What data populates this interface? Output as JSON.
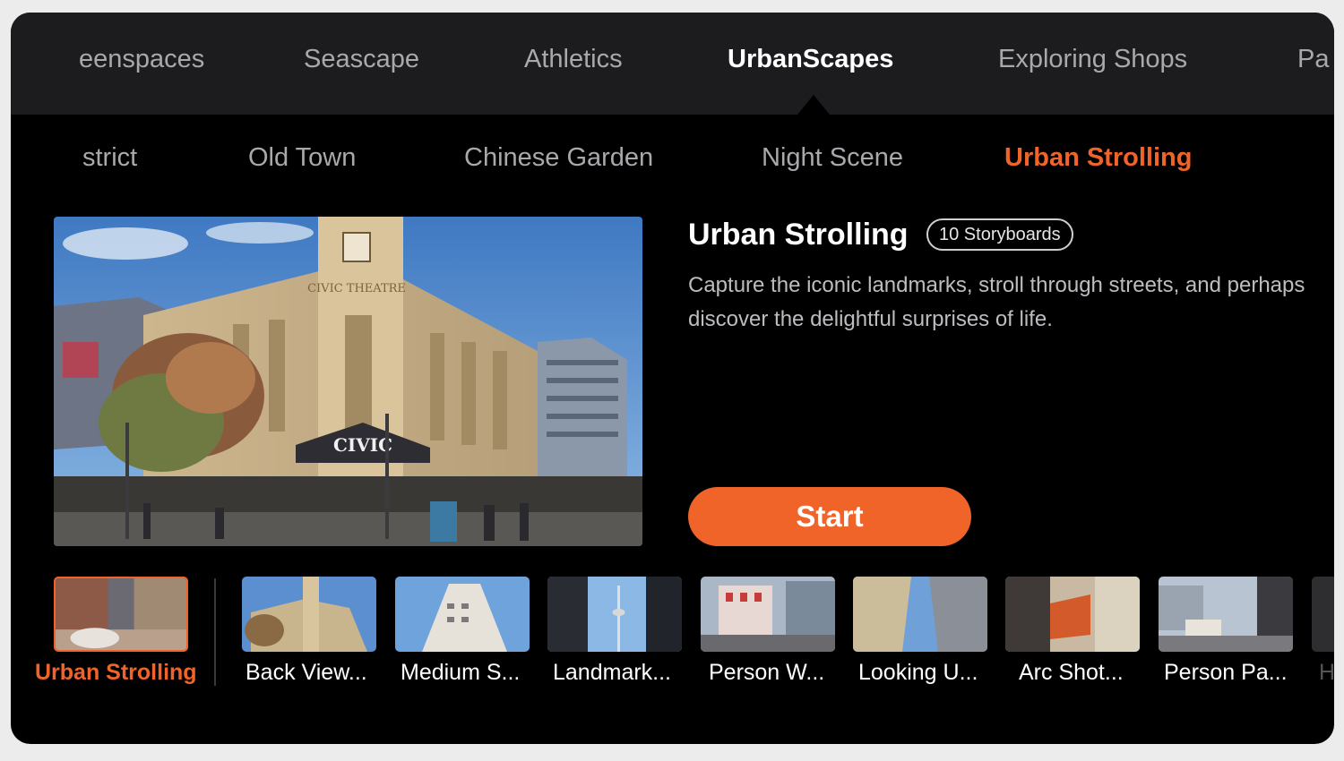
{
  "categories": [
    {
      "label": "eenspaces",
      "active": false
    },
    {
      "label": "Seascape",
      "active": false
    },
    {
      "label": "Athletics",
      "active": false
    },
    {
      "label": "UrbanScapes",
      "active": true
    },
    {
      "label": "Exploring Shops",
      "active": false
    },
    {
      "label": "Pa",
      "active": false
    }
  ],
  "subcategories": [
    {
      "label": "strict",
      "active": false
    },
    {
      "label": "Old Town",
      "active": false
    },
    {
      "label": "Chinese Garden",
      "active": false
    },
    {
      "label": "Night Scene",
      "active": false
    },
    {
      "label": "Urban Strolling",
      "active": true
    }
  ],
  "detail": {
    "title": "Urban Strolling",
    "badge": "10 Storyboards",
    "description": "Capture the iconic landmarks, stroll through streets, and perhaps discover the delightful surprises of life.",
    "start_label": "Start"
  },
  "hero": {
    "sign_civic": "CIVIC",
    "sign_theatre": "CIVIC THEATRE"
  },
  "storyboards": [
    {
      "label": "Urban Strolling",
      "active": true
    },
    {
      "label": "Back View...",
      "active": false
    },
    {
      "label": "Medium S...",
      "active": false
    },
    {
      "label": "Landmark...",
      "active": false
    },
    {
      "label": "Person W...",
      "active": false
    },
    {
      "label": "Looking U...",
      "active": false
    },
    {
      "label": "Arc Shot...",
      "active": false
    },
    {
      "label": "Person Pa...",
      "active": false
    },
    {
      "label": "H",
      "active": false
    }
  ],
  "colors": {
    "accent": "#f0642a",
    "topbar_bg": "#1c1c1e",
    "content_bg": "#000000",
    "inactive_text": "#a9a9ad"
  }
}
